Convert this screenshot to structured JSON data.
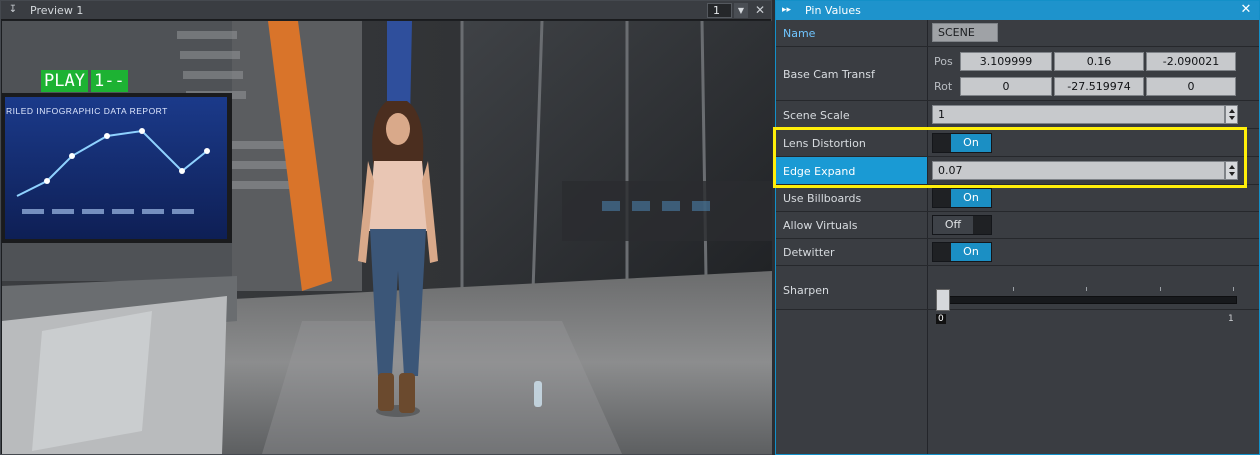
{
  "preview": {
    "title": "Preview 1",
    "channel": "1",
    "grip_icon": "collapse-arrow-icon",
    "overlay": {
      "play_label": "PLAY",
      "play_value": "1--",
      "monitor_title": "RILED INFOGRAPHIC DATA REPORT",
      "tag_color": "#1db233"
    }
  },
  "pin_values": {
    "title": "Pin Values",
    "accent": "#1e93cc",
    "name": {
      "label": "Name",
      "value": "SCENE"
    },
    "base_cam": {
      "label": "Base Cam Transf",
      "pos_label": "Pos",
      "pos": [
        "3.109999",
        "0.16",
        "-2.090021"
      ],
      "rot_label": "Rot",
      "rot": [
        "0",
        "-27.519974",
        "0"
      ]
    },
    "scene_scale": {
      "label": "Scene Scale",
      "value": "1"
    },
    "lens_distortion": {
      "label": "Lens Distortion",
      "state": "On"
    },
    "edge_expand": {
      "label": "Edge Expand",
      "value": "0.07"
    },
    "use_billboards": {
      "label": "Use Billboards",
      "state": "On"
    },
    "allow_virtuals": {
      "label": "Allow Virtuals",
      "state": "Off"
    },
    "detwitter": {
      "label": "Detwitter",
      "state": "On"
    },
    "sharpen": {
      "label": "Sharpen",
      "value": 0,
      "min": "0",
      "max": "1"
    }
  },
  "highlight_color": "#ffef0a"
}
